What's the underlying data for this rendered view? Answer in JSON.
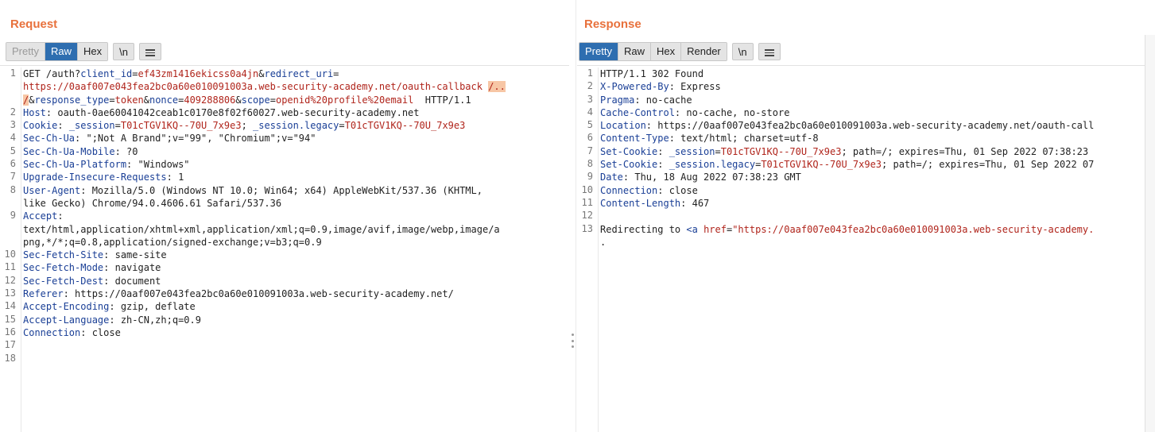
{
  "layout_toggle": {
    "options": [
      "side-by-side",
      "stacked",
      "single"
    ],
    "active": "side-by-side"
  },
  "request": {
    "title": "Request",
    "tabs": [
      "Pretty",
      "Raw",
      "Hex"
    ],
    "active_tab": "Raw",
    "newline_label": "\\n",
    "menu_icon": "menu-icon",
    "lines": [
      {
        "n": "1",
        "segs": [
          [
            {
              "t": "GET /auth?",
              "c": "hv"
            },
            {
              "t": "client_id",
              "c": "hk"
            },
            {
              "t": "=",
              "c": "hv"
            },
            {
              "t": "ef43zm1416ekicss0a4jn",
              "c": "red"
            },
            {
              "t": "&",
              "c": "hv"
            },
            {
              "t": "redirect_uri",
              "c": "hk"
            },
            {
              "t": "=",
              "c": "hv"
            }
          ],
          [
            {
              "t": "https://0aaf007e043fea2bc0a60e010091003a.web-security-academy.net/oauth-callback",
              "c": "red"
            },
            {
              "t": " ",
              "c": "hv"
            },
            {
              "t": "/..",
              "c": "red hl"
            }
          ],
          [
            {
              "t": "/",
              "c": "red hl"
            },
            {
              "t": "&",
              "c": "hv"
            },
            {
              "t": "response_type",
              "c": "hk"
            },
            {
              "t": "=",
              "c": "hv"
            },
            {
              "t": "token",
              "c": "red"
            },
            {
              "t": "&",
              "c": "hv"
            },
            {
              "t": "nonce",
              "c": "hk"
            },
            {
              "t": "=",
              "c": "hv"
            },
            {
              "t": "409288806",
              "c": "red"
            },
            {
              "t": "&",
              "c": "hv"
            },
            {
              "t": "scope",
              "c": "hk"
            },
            {
              "t": "=",
              "c": "hv"
            },
            {
              "t": "openid%20profile%20email",
              "c": "red"
            },
            {
              "t": "  HTTP/1.1",
              "c": "hv"
            }
          ]
        ]
      },
      {
        "n": "2",
        "segs": [
          [
            {
              "t": "Host",
              "c": "hk"
            },
            {
              "t": ": oauth-0ae60041042ceab1c0170e8f02f60027.web-security-academy.net",
              "c": "hv"
            }
          ]
        ]
      },
      {
        "n": "3",
        "segs": [
          [
            {
              "t": "Cookie",
              "c": "hk"
            },
            {
              "t": ": ",
              "c": "hv"
            },
            {
              "t": "_session",
              "c": "hk"
            },
            {
              "t": "=",
              "c": "hv"
            },
            {
              "t": "T01cTGV1KQ--70U_7x9e3",
              "c": "red"
            },
            {
              "t": "; ",
              "c": "hv"
            },
            {
              "t": "_session.legacy",
              "c": "hk"
            },
            {
              "t": "=",
              "c": "hv"
            },
            {
              "t": "T01cTGV1KQ--70U_7x9e3",
              "c": "red"
            }
          ]
        ]
      },
      {
        "n": "4",
        "segs": [
          [
            {
              "t": "Sec-Ch-Ua",
              "c": "hk"
            },
            {
              "t": ": \";Not A Brand\";v=\"99\", \"Chromium\";v=\"94\"",
              "c": "hv"
            }
          ]
        ]
      },
      {
        "n": "5",
        "segs": [
          [
            {
              "t": "Sec-Ch-Ua-Mobile",
              "c": "hk"
            },
            {
              "t": ": ?0",
              "c": "hv"
            }
          ]
        ]
      },
      {
        "n": "6",
        "segs": [
          [
            {
              "t": "Sec-Ch-Ua-Platform",
              "c": "hk"
            },
            {
              "t": ": \"Windows\"",
              "c": "hv"
            }
          ]
        ]
      },
      {
        "n": "7",
        "segs": [
          [
            {
              "t": "Upgrade-Insecure-Requests",
              "c": "hk"
            },
            {
              "t": ": 1",
              "c": "hv"
            }
          ]
        ]
      },
      {
        "n": "8",
        "segs": [
          [
            {
              "t": "User-Agent",
              "c": "hk"
            },
            {
              "t": ": Mozilla/5.0 (Windows NT 10.0; Win64; x64) AppleWebKit/537.36 (KHTML,",
              "c": "hv"
            }
          ],
          [
            {
              "t": "like Gecko) Chrome/94.0.4606.61 Safari/537.36",
              "c": "hv"
            }
          ]
        ]
      },
      {
        "n": "9",
        "segs": [
          [
            {
              "t": "Accept",
              "c": "hk"
            },
            {
              "t": ":",
              "c": "hv"
            }
          ],
          [
            {
              "t": "text/html,application/xhtml+xml,application/xml;q=0.9,image/avif,image/webp,image/a",
              "c": "hv"
            }
          ],
          [
            {
              "t": "png,*/*;q=0.8,application/signed-exchange;v=b3;q=0.9",
              "c": "hv"
            }
          ]
        ]
      },
      {
        "n": "10",
        "segs": [
          [
            {
              "t": "Sec-Fetch-Site",
              "c": "hk"
            },
            {
              "t": ": same-site",
              "c": "hv"
            }
          ]
        ]
      },
      {
        "n": "11",
        "segs": [
          [
            {
              "t": "Sec-Fetch-Mode",
              "c": "hk"
            },
            {
              "t": ": navigate",
              "c": "hv"
            }
          ]
        ]
      },
      {
        "n": "12",
        "segs": [
          [
            {
              "t": "Sec-Fetch-Dest",
              "c": "hk"
            },
            {
              "t": ": document",
              "c": "hv"
            }
          ]
        ]
      },
      {
        "n": "13",
        "segs": [
          [
            {
              "t": "Referer",
              "c": "hk"
            },
            {
              "t": ": https://0aaf007e043fea2bc0a60e010091003a.web-security-academy.net/",
              "c": "hv"
            }
          ]
        ]
      },
      {
        "n": "14",
        "segs": [
          [
            {
              "t": "Accept-Encoding",
              "c": "hk"
            },
            {
              "t": ": gzip, deflate",
              "c": "hv"
            }
          ]
        ]
      },
      {
        "n": "15",
        "segs": [
          [
            {
              "t": "Accept-Language",
              "c": "hk"
            },
            {
              "t": ": zh-CN,zh;q=0.9",
              "c": "hv"
            }
          ]
        ]
      },
      {
        "n": "16",
        "segs": [
          [
            {
              "t": "Connection",
              "c": "hk"
            },
            {
              "t": ": close",
              "c": "hv"
            }
          ]
        ]
      },
      {
        "n": "17",
        "segs": [
          [
            {
              "t": "",
              "c": "hv"
            }
          ]
        ]
      },
      {
        "n": "18",
        "segs": [
          [
            {
              "t": "",
              "c": "hv"
            }
          ]
        ]
      }
    ]
  },
  "response": {
    "title": "Response",
    "tabs": [
      "Pretty",
      "Raw",
      "Hex",
      "Render"
    ],
    "active_tab": "Pretty",
    "newline_label": "\\n",
    "menu_icon": "menu-icon",
    "lines": [
      {
        "n": "1",
        "segs": [
          [
            {
              "t": "HTTP/1.1 302 Found",
              "c": "hv"
            }
          ]
        ]
      },
      {
        "n": "2",
        "segs": [
          [
            {
              "t": "X-Powered-By",
              "c": "hk"
            },
            {
              "t": ": Express",
              "c": "hv"
            }
          ]
        ]
      },
      {
        "n": "3",
        "segs": [
          [
            {
              "t": "Pragma",
              "c": "hk"
            },
            {
              "t": ": no-cache",
              "c": "hv"
            }
          ]
        ]
      },
      {
        "n": "4",
        "segs": [
          [
            {
              "t": "Cache-Control",
              "c": "hk"
            },
            {
              "t": ": no-cache, no-store",
              "c": "hv"
            }
          ]
        ]
      },
      {
        "n": "5",
        "segs": [
          [
            {
              "t": "Location",
              "c": "hk"
            },
            {
              "t": ": https://0aaf007e043fea2bc0a60e010091003a.web-security-academy.net/oauth-call",
              "c": "hv"
            }
          ]
        ]
      },
      {
        "n": "6",
        "segs": [
          [
            {
              "t": "Content-Type",
              "c": "hk"
            },
            {
              "t": ": text/html; charset=utf-8",
              "c": "hv"
            }
          ]
        ]
      },
      {
        "n": "7",
        "segs": [
          [
            {
              "t": "Set-Cookie",
              "c": "hk"
            },
            {
              "t": ": ",
              "c": "hv"
            },
            {
              "t": "_session",
              "c": "hk"
            },
            {
              "t": "=",
              "c": "hv"
            },
            {
              "t": "T01cTGV1KQ--70U_7x9e3",
              "c": "red"
            },
            {
              "t": "; path=/; expires=Thu, 01 Sep 2022 07:38:23",
              "c": "hv"
            }
          ]
        ]
      },
      {
        "n": "8",
        "segs": [
          [
            {
              "t": "Set-Cookie",
              "c": "hk"
            },
            {
              "t": ": ",
              "c": "hv"
            },
            {
              "t": "_session.legacy",
              "c": "hk"
            },
            {
              "t": "=",
              "c": "hv"
            },
            {
              "t": "T01cTGV1KQ--70U_7x9e3",
              "c": "red"
            },
            {
              "t": "; path=/; expires=Thu, 01 Sep 2022 07",
              "c": "hv"
            }
          ]
        ]
      },
      {
        "n": "9",
        "segs": [
          [
            {
              "t": "Date",
              "c": "hk"
            },
            {
              "t": ": Thu, 18 Aug 2022 07:38:23 GMT",
              "c": "hv"
            }
          ]
        ]
      },
      {
        "n": "10",
        "segs": [
          [
            {
              "t": "Connection",
              "c": "hk"
            },
            {
              "t": ": close",
              "c": "hv"
            }
          ]
        ]
      },
      {
        "n": "11",
        "segs": [
          [
            {
              "t": "Content-Length",
              "c": "hk"
            },
            {
              "t": ": 467",
              "c": "hv"
            }
          ]
        ]
      },
      {
        "n": "12",
        "segs": [
          [
            {
              "t": "",
              "c": "hv"
            }
          ]
        ]
      },
      {
        "n": "13",
        "segs": [
          [
            {
              "t": "Redirecting to ",
              "c": "hv"
            },
            {
              "t": "<a ",
              "c": "hk"
            },
            {
              "t": "href",
              "c": "red"
            },
            {
              "t": "=",
              "c": "hv"
            },
            {
              "t": "\"https://0aaf007e043fea2bc0a60e010091003a.web-security-academy.",
              "c": "red"
            }
          ],
          [
            {
              "t": ".",
              "c": "hv"
            }
          ]
        ]
      }
    ]
  }
}
